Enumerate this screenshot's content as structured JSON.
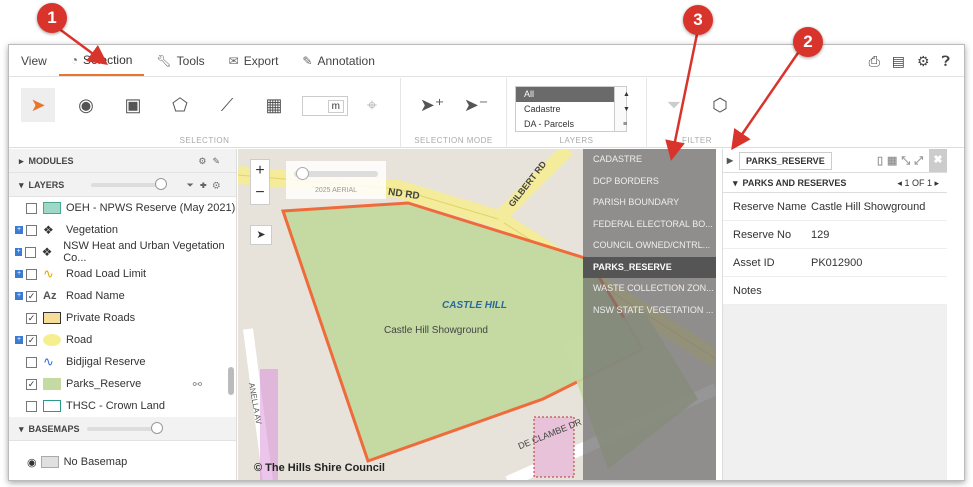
{
  "tabs": [
    {
      "label": "View",
      "icon": ""
    },
    {
      "label": "Selection",
      "icon": "selection-icon"
    },
    {
      "label": "Tools",
      "icon": "wrench-icon"
    },
    {
      "label": "Export",
      "icon": "envelope-icon"
    },
    {
      "label": "Annotation",
      "icon": "pencil-icon"
    }
  ],
  "ribbon": {
    "distance_unit": "m",
    "group_selection": "SELECTION",
    "group_selection_mode": "SELECTION MODE",
    "group_layers": "LAYERS",
    "group_filter": "FILTER",
    "layer_options": [
      "All",
      "Cadastre",
      "DA - Parcels"
    ]
  },
  "left": {
    "modules": "MODULES",
    "layers": "LAYERS",
    "items": [
      {
        "label": "OEH - NPWS Reserve (May 2021)",
        "checked": false,
        "expand": false
      },
      {
        "label": "Vegetation",
        "checked": false,
        "expand": true
      },
      {
        "label": "NSW Heat and Urban Vegetation Co...",
        "checked": false,
        "expand": true
      },
      {
        "label": "Road Load Limit",
        "checked": false,
        "expand": true
      },
      {
        "label": "Road Name",
        "checked": true,
        "expand": true
      },
      {
        "label": "Private Roads",
        "checked": true,
        "expand": false
      },
      {
        "label": "Road",
        "checked": true,
        "expand": true
      },
      {
        "label": "Bidjigal Reserve",
        "checked": false,
        "expand": false
      },
      {
        "label": "Parks_Reserve",
        "checked": true,
        "expand": false
      },
      {
        "label": "THSC - Crown Land",
        "checked": false,
        "expand": false
      }
    ],
    "basemaps": "BASEMAPS",
    "basemap_option": "No Basemap"
  },
  "map": {
    "aerial_label": "2025 AERIAL",
    "road_nd": "ND RD",
    "road_gilbert": "GILBERT RD",
    "road_anella": "ANELLA AV",
    "road_declambe": "DE CLAMBE DR",
    "suburb": "CASTLE HILL",
    "park": "Castle Hill Showground",
    "copyright": "© The Hills Shire Council",
    "layer_popup": [
      "CADASTRE",
      "DCP BORDERS",
      "PARISH BOUNDARY",
      "FEDERAL ELECTORAL BO...",
      "COUNCIL OWNED/CNTRL...",
      "PARKS_RESERVE",
      "WASTE COLLECTION ZON...",
      "NSW STATE VEGETATION ..."
    ],
    "popup_active_index": 5
  },
  "right": {
    "title": "PARKS_RESERVE",
    "section": "PARKS AND RESERVES",
    "pager": "1 OF 1",
    "attributes": [
      {
        "key": "Reserve Name",
        "value": "Castle Hill Showground"
      },
      {
        "key": "Reserve No",
        "value": "129"
      },
      {
        "key": "Asset ID",
        "value": "PK012900"
      },
      {
        "key": "Notes",
        "value": ""
      }
    ]
  },
  "callouts": [
    "1",
    "2",
    "3"
  ],
  "colors": {
    "accent": "#e8752a",
    "callout": "#d9342b",
    "park": "#c5d9a3"
  }
}
